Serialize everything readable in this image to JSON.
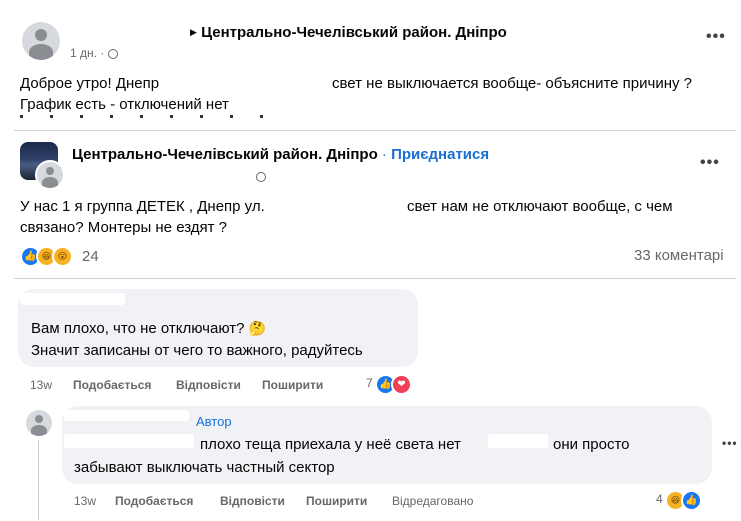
{
  "post1": {
    "group_name": "Центрально-Чечелівський район. Дніпро",
    "time": "1 дн.",
    "separator": "·",
    "line1_a": "Доброе утро! Днепр",
    "line1_b": "свет не выключается вообще- объясните причину ?",
    "line2": "График есть - отключений нет"
  },
  "post2": {
    "group_name": "Центрально-Чечелівський район. Дніпро",
    "join_prefix": "·",
    "join_label": "Приєднатися",
    "text_line1_a": "У нас 1 я группа ДЕТЕК , Днепр ул.",
    "text_line1_b": "свет нам не отключают вообще, с чем",
    "text_line2": "связано? Монтеры не ездят ?",
    "reactions_count": "24",
    "comments_count": "33 коментарі"
  },
  "comment1": {
    "line1": "Вам плохо, что не отключают?",
    "line2": "Значит записаны от чего то важного, радуйтесь",
    "time": "13w",
    "like_label": "Подобається",
    "reply_label": "Відповісти",
    "share_label": "Поширити",
    "reactions_count": "7"
  },
  "comment2": {
    "author_badge": "Автор",
    "line1_a": "плохо теща приехала у неё света нет",
    "line1_b": "они просто",
    "line2": "забывают выключать частный сектор",
    "time": "13w",
    "like_label": "Подобається",
    "reply_label": "Відповісти",
    "share_label": "Поширити",
    "edited_label": "Відредаговано",
    "reactions_count": "4"
  },
  "icons": {
    "more": "more-horizontal-icon",
    "globe": "globe-icon",
    "play": "triangle-right-icon",
    "like": "like-reaction-icon",
    "love": "love-reaction-icon",
    "haha": "haha-reaction-icon",
    "wow": "wow-reaction-icon"
  },
  "colors": {
    "link_blue": "#1a6fd1",
    "muted": "#65676b",
    "bubble": "#f0f2f5"
  }
}
